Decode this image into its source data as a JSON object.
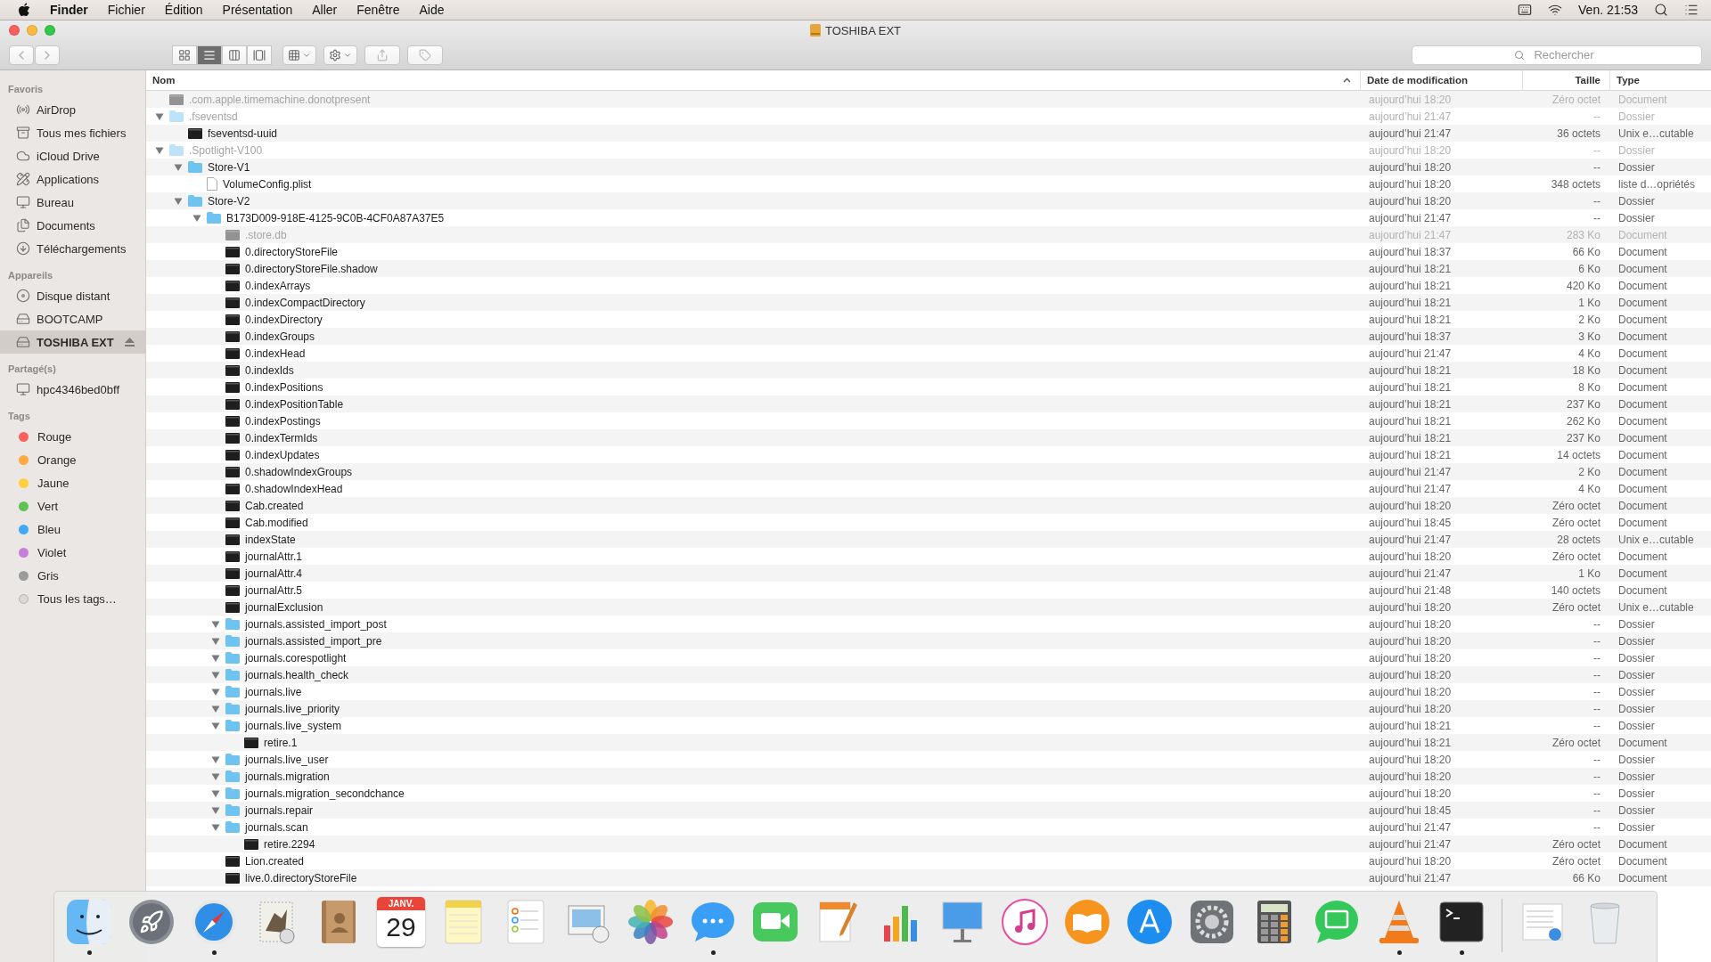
{
  "menubar": {
    "app": "Finder",
    "menus": [
      "Fichier",
      "Édition",
      "Présentation",
      "Aller",
      "Fenêtre",
      "Aide"
    ],
    "clock": "Ven. 21:53"
  },
  "window": {
    "title": "TOSHIBA EXT"
  },
  "toolbar": {
    "views": [
      {
        "kind": "icons",
        "selected": false
      },
      {
        "kind": "list",
        "selected": true
      },
      {
        "kind": "columns",
        "selected": false
      },
      {
        "kind": "cover",
        "selected": false
      }
    ],
    "search": {
      "placeholder": "Rechercher"
    }
  },
  "sidebar": {
    "sections": [
      {
        "title": "Favoris",
        "items": [
          {
            "label": "AirDrop",
            "kind": "airdrop",
            "selected": false
          },
          {
            "label": "Tous mes fichiers",
            "kind": "allfiles",
            "selected": false
          },
          {
            "label": "iCloud Drive",
            "kind": "cloud",
            "selected": false
          },
          {
            "label": "Applications",
            "kind": "apps",
            "selected": false
          },
          {
            "label": "Bureau",
            "kind": "desktop",
            "selected": false
          },
          {
            "label": "Documents",
            "kind": "documents",
            "selected": false
          },
          {
            "label": "Téléchargements",
            "kind": "downloads",
            "selected": false
          }
        ]
      },
      {
        "title": "Appareils",
        "items": [
          {
            "label": "Disque distant",
            "kind": "disc",
            "selected": false,
            "eject": false
          },
          {
            "label": "BOOTCAMP",
            "kind": "drive",
            "selected": false,
            "eject": false
          },
          {
            "label": "TOSHIBA EXT",
            "kind": "drive",
            "selected": true,
            "eject": true
          }
        ]
      },
      {
        "title": "Partagé(s)",
        "items": [
          {
            "label": "hpc4346bed0bff",
            "kind": "computer",
            "selected": false
          }
        ]
      },
      {
        "title": "Tags",
        "items": [
          {
            "label": "Rouge",
            "kind": "tag",
            "color": "#fc605c",
            "selected": false
          },
          {
            "label": "Orange",
            "kind": "tag",
            "color": "#fdaa3f",
            "selected": false
          },
          {
            "label": "Jaune",
            "kind": "tag",
            "color": "#fecf3f",
            "selected": false
          },
          {
            "label": "Vert",
            "kind": "tag",
            "color": "#5dc451",
            "selected": false
          },
          {
            "label": "Bleu",
            "kind": "tag",
            "color": "#3fa9f5",
            "selected": false
          },
          {
            "label": "Violet",
            "kind": "tag",
            "color": "#c57fdb",
            "selected": false
          },
          {
            "label": "Gris",
            "kind": "tag",
            "color": "#9b9b9b",
            "selected": false
          },
          {
            "label": "Tous les tags…",
            "kind": "alltags",
            "selected": false
          }
        ]
      }
    ]
  },
  "table": {
    "columns": [
      {
        "label": "Nom",
        "sorted": true
      },
      {
        "label": "Date de modification",
        "sorted": false
      },
      {
        "label": "Taille",
        "sorted": false
      },
      {
        "label": "Type",
        "sorted": false
      }
    ],
    "files": [
      {
        "name": ".com.apple.timemachine.donotpresent",
        "kind": "executable",
        "hidden": true,
        "date": "aujourd’hui 18:20",
        "size": "Zéro octet",
        "type": "Document"
      },
      {
        "name": ".fseventsd",
        "kind": "folder",
        "hidden": true,
        "expanded": true,
        "date": "aujourd’hui 21:47",
        "size": "--",
        "type": "Dossier",
        "children": [
          {
            "name": "fseventsd-uuid",
            "kind": "executable",
            "hidden": false,
            "date": "aujourd’hui 21:47",
            "size": "36 octets",
            "type": "Unix e…cutable"
          }
        ]
      },
      {
        "name": ".Spotlight-V100",
        "kind": "folder",
        "hidden": true,
        "expanded": true,
        "date": "aujourd’hui 18:20",
        "size": "--",
        "type": "Dossier",
        "children": [
          {
            "name": "Store-V1",
            "kind": "folder",
            "hidden": false,
            "expanded": true,
            "date": "aujourd’hui 18:20",
            "size": "--",
            "type": "Dossier",
            "children": [
              {
                "name": "VolumeConfig.plist",
                "kind": "document",
                "hidden": false,
                "date": "aujourd’hui 18:20",
                "size": "348 octets",
                "type": "liste d…opriétés"
              }
            ]
          },
          {
            "name": "Store-V2",
            "kind": "folder",
            "hidden": false,
            "expanded": true,
            "date": "aujourd’hui 18:20",
            "size": "--",
            "type": "Dossier",
            "children": [
              {
                "name": "B173D009-918E-4125-9C0B-4CF0A87A37E5",
                "kind": "folder",
                "hidden": false,
                "expanded": true,
                "date": "aujourd’hui 21:47",
                "size": "--",
                "type": "Dossier",
                "children": [
                  {
                    "name": ".store.db",
                    "kind": "executable",
                    "hidden": true,
                    "date": "aujourd’hui 21:47",
                    "size": "283 Ko",
                    "type": "Document"
                  },
                  {
                    "name": "0.directoryStoreFile",
                    "kind": "executable",
                    "hidden": false,
                    "date": "aujourd’hui 18:37",
                    "size": "66 Ko",
                    "type": "Document"
                  },
                  {
                    "name": "0.directoryStoreFile.shadow",
                    "kind": "executable",
                    "hidden": false,
                    "date": "aujourd’hui 18:21",
                    "size": "6 Ko",
                    "type": "Document"
                  },
                  {
                    "name": "0.indexArrays",
                    "kind": "executable",
                    "hidden": false,
                    "date": "aujourd’hui 18:21",
                    "size": "420 Ko",
                    "type": "Document"
                  },
                  {
                    "name": "0.indexCompactDirectory",
                    "kind": "executable",
                    "hidden": false,
                    "date": "aujourd’hui 18:21",
                    "size": "1 Ko",
                    "type": "Document"
                  },
                  {
                    "name": "0.indexDirectory",
                    "kind": "executable",
                    "hidden": false,
                    "date": "aujourd’hui 18:21",
                    "size": "2 Ko",
                    "type": "Document"
                  },
                  {
                    "name": "0.indexGroups",
                    "kind": "executable",
                    "hidden": false,
                    "date": "aujourd’hui 18:37",
                    "size": "3 Ko",
                    "type": "Document"
                  },
                  {
                    "name": "0.indexHead",
                    "kind": "executable",
                    "hidden": false,
                    "date": "aujourd’hui 21:47",
                    "size": "4 Ko",
                    "type": "Document"
                  },
                  {
                    "name": "0.indexIds",
                    "kind": "executable",
                    "hidden": false,
                    "date": "aujourd’hui 18:21",
                    "size": "18 Ko",
                    "type": "Document"
                  },
                  {
                    "name": "0.indexPositions",
                    "kind": "executable",
                    "hidden": false,
                    "date": "aujourd’hui 18:21",
                    "size": "8 Ko",
                    "type": "Document"
                  },
                  {
                    "name": "0.indexPositionTable",
                    "kind": "executable",
                    "hidden": false,
                    "date": "aujourd’hui 18:21",
                    "size": "237 Ko",
                    "type": "Document"
                  },
                  {
                    "name": "0.indexPostings",
                    "kind": "executable",
                    "hidden": false,
                    "date": "aujourd’hui 18:21",
                    "size": "262 Ko",
                    "type": "Document"
                  },
                  {
                    "name": "0.indexTermIds",
                    "kind": "executable",
                    "hidden": false,
                    "date": "aujourd’hui 18:21",
                    "size": "237 Ko",
                    "type": "Document"
                  },
                  {
                    "name": "0.indexUpdates",
                    "kind": "executable",
                    "hidden": false,
                    "date": "aujourd’hui 18:21",
                    "size": "14 octets",
                    "type": "Document"
                  },
                  {
                    "name": "0.shadowIndexGroups",
                    "kind": "executable",
                    "hidden": false,
                    "date": "aujourd’hui 21:47",
                    "size": "2 Ko",
                    "type": "Document"
                  },
                  {
                    "name": "0.shadowIndexHead",
                    "kind": "executable",
                    "hidden": false,
                    "date": "aujourd’hui 21:47",
                    "size": "4 Ko",
                    "type": "Document"
                  },
                  {
                    "name": "Cab.created",
                    "kind": "executable",
                    "hidden": false,
                    "date": "aujourd’hui 18:20",
                    "size": "Zéro octet",
                    "type": "Document"
                  },
                  {
                    "name": "Cab.modified",
                    "kind": "executable",
                    "hidden": false,
                    "date": "aujourd’hui 18:45",
                    "size": "Zéro octet",
                    "type": "Document"
                  },
                  {
                    "name": "indexState",
                    "kind": "executable",
                    "hidden": false,
                    "date": "aujourd’hui 21:47",
                    "size": "28 octets",
                    "type": "Unix e…cutable"
                  },
                  {
                    "name": "journalAttr.1",
                    "kind": "executable",
                    "hidden": false,
                    "date": "aujourd’hui 18:20",
                    "size": "Zéro octet",
                    "type": "Document"
                  },
                  {
                    "name": "journalAttr.4",
                    "kind": "executable",
                    "hidden": false,
                    "date": "aujourd’hui 21:47",
                    "size": "1 Ko",
                    "type": "Document"
                  },
                  {
                    "name": "journalAttr.5",
                    "kind": "executable",
                    "hidden": false,
                    "date": "aujourd’hui 21:48",
                    "size": "140 octets",
                    "type": "Document"
                  },
                  {
                    "name": "journalExclusion",
                    "kind": "executable",
                    "hidden": false,
                    "date": "aujourd’hui 18:20",
                    "size": "Zéro octet",
                    "type": "Unix e…cutable"
                  },
                  {
                    "name": "journals.assisted_import_post",
                    "kind": "folder",
                    "hidden": false,
                    "expanded": true,
                    "date": "aujourd’hui 18:20",
                    "size": "--",
                    "type": "Dossier"
                  },
                  {
                    "name": "journals.assisted_import_pre",
                    "kind": "folder",
                    "hidden": false,
                    "expanded": true,
                    "date": "aujourd’hui 18:20",
                    "size": "--",
                    "type": "Dossier"
                  },
                  {
                    "name": "journals.corespotlight",
                    "kind": "folder",
                    "hidden": false,
                    "expanded": true,
                    "date": "aujourd’hui 18:20",
                    "size": "--",
                    "type": "Dossier"
                  },
                  {
                    "name": "journals.health_check",
                    "kind": "folder",
                    "hidden": false,
                    "expanded": true,
                    "date": "aujourd’hui 18:20",
                    "size": "--",
                    "type": "Dossier"
                  },
                  {
                    "name": "journals.live",
                    "kind": "folder",
                    "hidden": false,
                    "expanded": true,
                    "date": "aujourd’hui 18:20",
                    "size": "--",
                    "type": "Dossier"
                  },
                  {
                    "name": "journals.live_priority",
                    "kind": "folder",
                    "hidden": false,
                    "expanded": true,
                    "date": "aujourd’hui 18:20",
                    "size": "--",
                    "type": "Dossier"
                  },
                  {
                    "name": "journals.live_system",
                    "kind": "folder",
                    "hidden": false,
                    "expanded": true,
                    "date": "aujourd’hui 18:21",
                    "size": "--",
                    "type": "Dossier",
                    "children": [
                      {
                        "name": "retire.1",
                        "kind": "executable",
                        "hidden": false,
                        "date": "aujourd’hui 18:21",
                        "size": "Zéro octet",
                        "type": "Document"
                      }
                    ]
                  },
                  {
                    "name": "journals.live_user",
                    "kind": "folder",
                    "hidden": false,
                    "expanded": true,
                    "date": "aujourd’hui 18:20",
                    "size": "--",
                    "type": "Dossier"
                  },
                  {
                    "name": "journals.migration",
                    "kind": "folder",
                    "hidden": false,
                    "expanded": true,
                    "date": "aujourd’hui 18:20",
                    "size": "--",
                    "type": "Dossier"
                  },
                  {
                    "name": "journals.migration_secondchance",
                    "kind": "folder",
                    "hidden": false,
                    "expanded": true,
                    "date": "aujourd’hui 18:20",
                    "size": "--",
                    "type": "Dossier"
                  },
                  {
                    "name": "journals.repair",
                    "kind": "folder",
                    "hidden": false,
                    "expanded": true,
                    "date": "aujourd’hui 18:45",
                    "size": "--",
                    "type": "Dossier"
                  },
                  {
                    "name": "journals.scan",
                    "kind": "folder",
                    "hidden": false,
                    "expanded": true,
                    "date": "aujourd’hui 21:47",
                    "size": "--",
                    "type": "Dossier",
                    "children": [
                      {
                        "name": "retire.2294",
                        "kind": "executable",
                        "hidden": false,
                        "date": "aujourd’hui 21:47",
                        "size": "Zéro octet",
                        "type": "Document"
                      }
                    ]
                  },
                  {
                    "name": "Lion.created",
                    "kind": "executable",
                    "hidden": false,
                    "date": "aujourd’hui 18:20",
                    "size": "Zéro octet",
                    "type": "Document"
                  },
                  {
                    "name": "live.0.directoryStoreFile",
                    "kind": "executable",
                    "hidden": false,
                    "date": "aujourd’hui 21:47",
                    "size": "66 Ko",
                    "type": "Document"
                  }
                ]
              }
            ]
          }
        ]
      }
    ]
  },
  "dock": {
    "items": [
      {
        "kind": "finder",
        "running": true
      },
      {
        "kind": "launchpad",
        "running": false
      },
      {
        "kind": "safari",
        "running": true
      },
      {
        "kind": "mail",
        "running": false
      },
      {
        "kind": "contacts",
        "running": false
      },
      {
        "kind": "calendar",
        "running": false,
        "month": "JANV.",
        "day": "29"
      },
      {
        "kind": "notes",
        "running": false
      },
      {
        "kind": "reminders",
        "running": false
      },
      {
        "kind": "preview",
        "running": false
      },
      {
        "kind": "photos",
        "running": false
      },
      {
        "kind": "messages",
        "running": true
      },
      {
        "kind": "facetime",
        "running": false
      },
      {
        "kind": "pages",
        "running": false
      },
      {
        "kind": "numbers",
        "running": false
      },
      {
        "kind": "keynote",
        "running": false
      },
      {
        "kind": "music",
        "running": false
      },
      {
        "kind": "books",
        "running": false
      },
      {
        "kind": "store",
        "running": false
      },
      {
        "kind": "settings",
        "running": false
      },
      {
        "kind": "calculator",
        "running": false
      },
      {
        "kind": "chat",
        "running": false
      },
      {
        "kind": "vlc",
        "running": true
      },
      {
        "kind": "terminal",
        "running": true
      },
      {
        "kind": "separator"
      },
      {
        "kind": "thumbnail",
        "running": false
      },
      {
        "kind": "trash",
        "running": false
      }
    ]
  }
}
